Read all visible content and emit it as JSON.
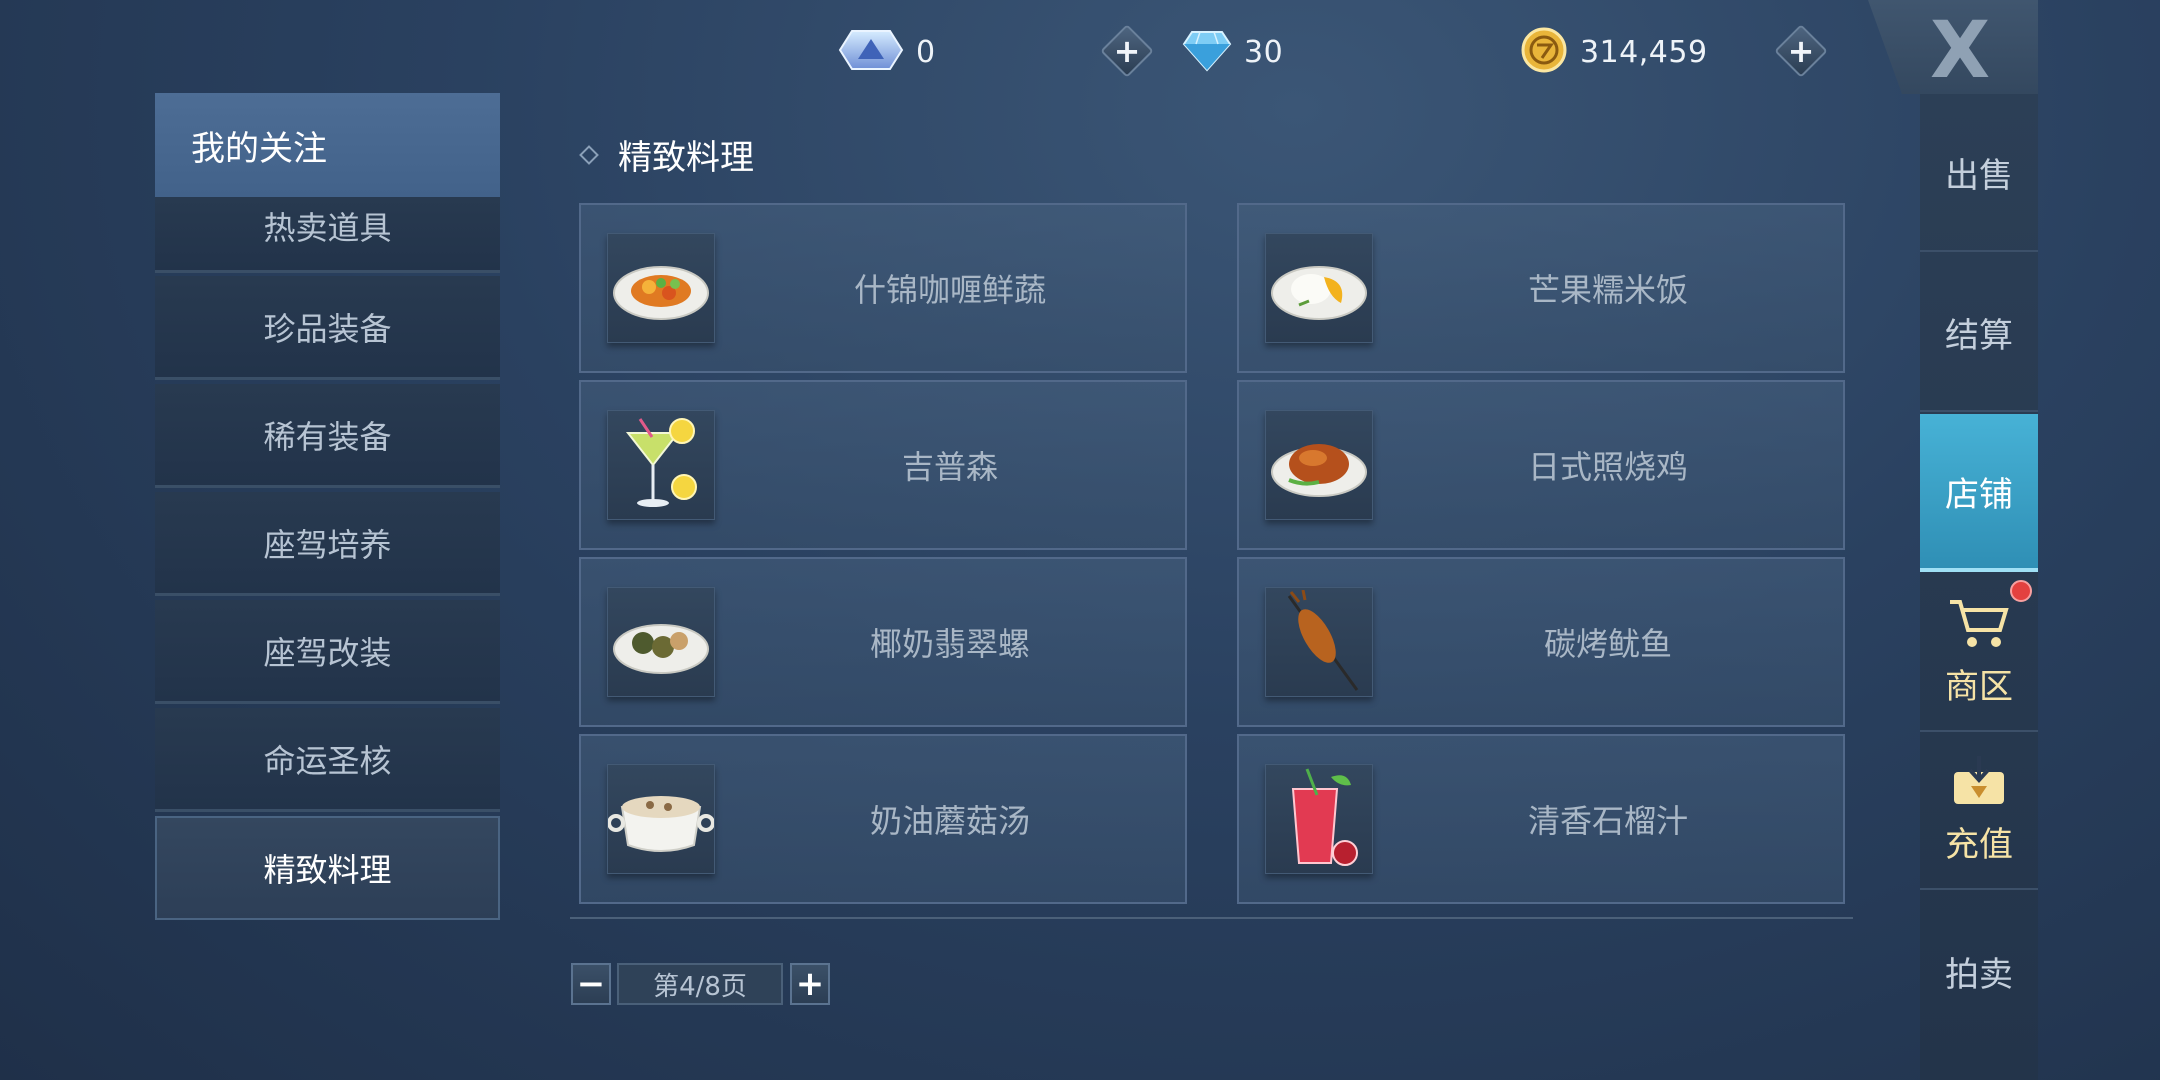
{
  "currencies": [
    {
      "name": "crystal-ticket",
      "value": "0"
    },
    {
      "name": "diamond",
      "value": "30"
    },
    {
      "name": "gold-coin",
      "value": "314,459"
    }
  ],
  "sidebar": {
    "header": "我的关注",
    "items": [
      {
        "label": "热卖道具"
      },
      {
        "label": "珍品装备"
      },
      {
        "label": "稀有装备"
      },
      {
        "label": "座驾培养"
      },
      {
        "label": "座驾改装"
      },
      {
        "label": "命运圣核"
      },
      {
        "label": "精致料理",
        "active": true
      }
    ]
  },
  "section": {
    "title": "精致料理"
  },
  "items": [
    {
      "name": "什锦咖喱鲜蔬",
      "icon": "curry-dish-icon"
    },
    {
      "name": "芒果糯米饭",
      "icon": "mango-rice-icon"
    },
    {
      "name": "吉普森",
      "icon": "cocktail-icon"
    },
    {
      "name": "日式照烧鸡",
      "icon": "roast-chicken-icon"
    },
    {
      "name": "椰奶翡翠螺",
      "icon": "snail-dish-icon"
    },
    {
      "name": "碳烤鱿鱼",
      "icon": "grilled-squid-icon"
    },
    {
      "name": "奶油蘑菇汤",
      "icon": "soup-pot-icon"
    },
    {
      "name": "清香石榴汁",
      "icon": "pomegranate-juice-icon"
    }
  ],
  "pagination": {
    "text": "第4/8页",
    "minus": "−",
    "plus": "+"
  },
  "right_nav": [
    {
      "label": "出售"
    },
    {
      "label": "结算"
    },
    {
      "label": "店铺",
      "active": true
    },
    {
      "label": "商区",
      "icon": "cart-icon"
    },
    {
      "label": "充值",
      "icon": "recharge-icon"
    },
    {
      "label": "拍卖"
    }
  ],
  "close_label": "X",
  "colors": {
    "accent": "#47b2d6",
    "gold_text": "#f6e3a6",
    "badge": "#e3413f"
  }
}
